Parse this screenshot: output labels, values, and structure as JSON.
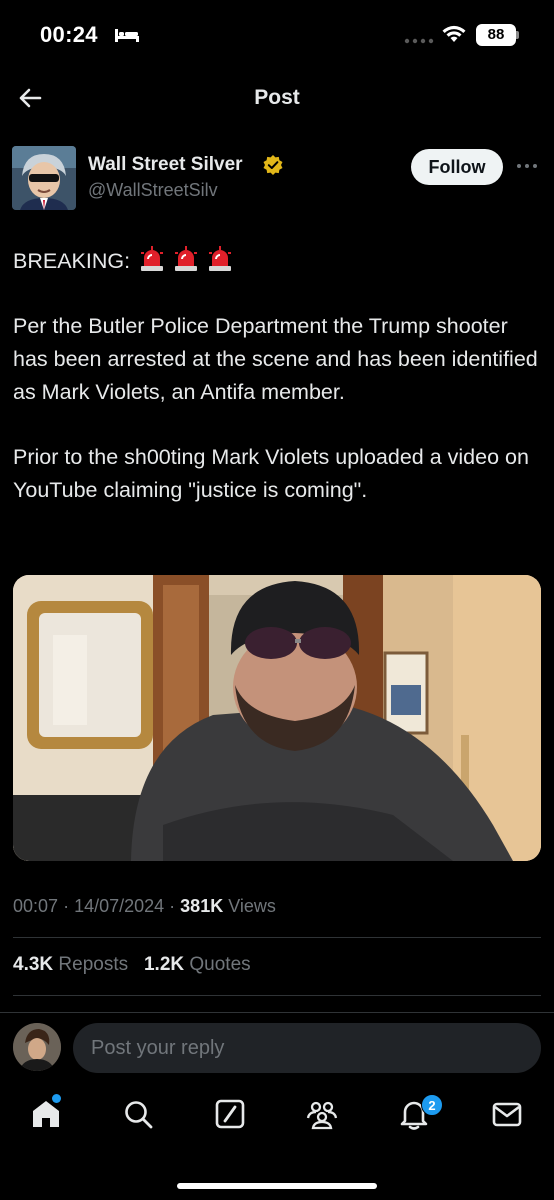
{
  "status_bar": {
    "time": "00:24",
    "battery": "88"
  },
  "header": {
    "title": "Post"
  },
  "author": {
    "name": "Wall Street Silver",
    "handle": "@WallStreetSilv",
    "follow_label": "Follow"
  },
  "post": {
    "breaking": "BREAKING:",
    "paragraph_1": "Per the Butler Police Department the Trump shooter has been arrested at the scene and has been identified as Mark Violets, an Antifa member.",
    "paragraph_2": "Prior to the sh00ting Mark Violets uploaded a video on YouTube claiming \"justice is coming\"."
  },
  "meta": {
    "time": "00:07",
    "date": "14/07/2024",
    "views_count": "381K",
    "views_label": "Views"
  },
  "stats": {
    "reposts_count": "4.3K",
    "reposts_label": "Reposts",
    "quotes_count": "1.2K",
    "quotes_label": "Quotes"
  },
  "reply": {
    "placeholder": "Post your reply"
  },
  "tabbar": {
    "notifications_badge": "2"
  },
  "colors": {
    "background": "#000000",
    "accent": "#1d9bf0",
    "verified_gold": "#e2b719",
    "muted_text": "#71767b"
  },
  "icons": {
    "back": "arrow-left-icon",
    "verified": "verified-badge-icon",
    "more": "more-dots-icon",
    "siren": "police-siren-icon",
    "home": "home-icon",
    "search": "search-icon",
    "grok": "grok-icon",
    "communities": "communities-icon",
    "notifications": "bell-icon",
    "messages": "mail-icon"
  }
}
